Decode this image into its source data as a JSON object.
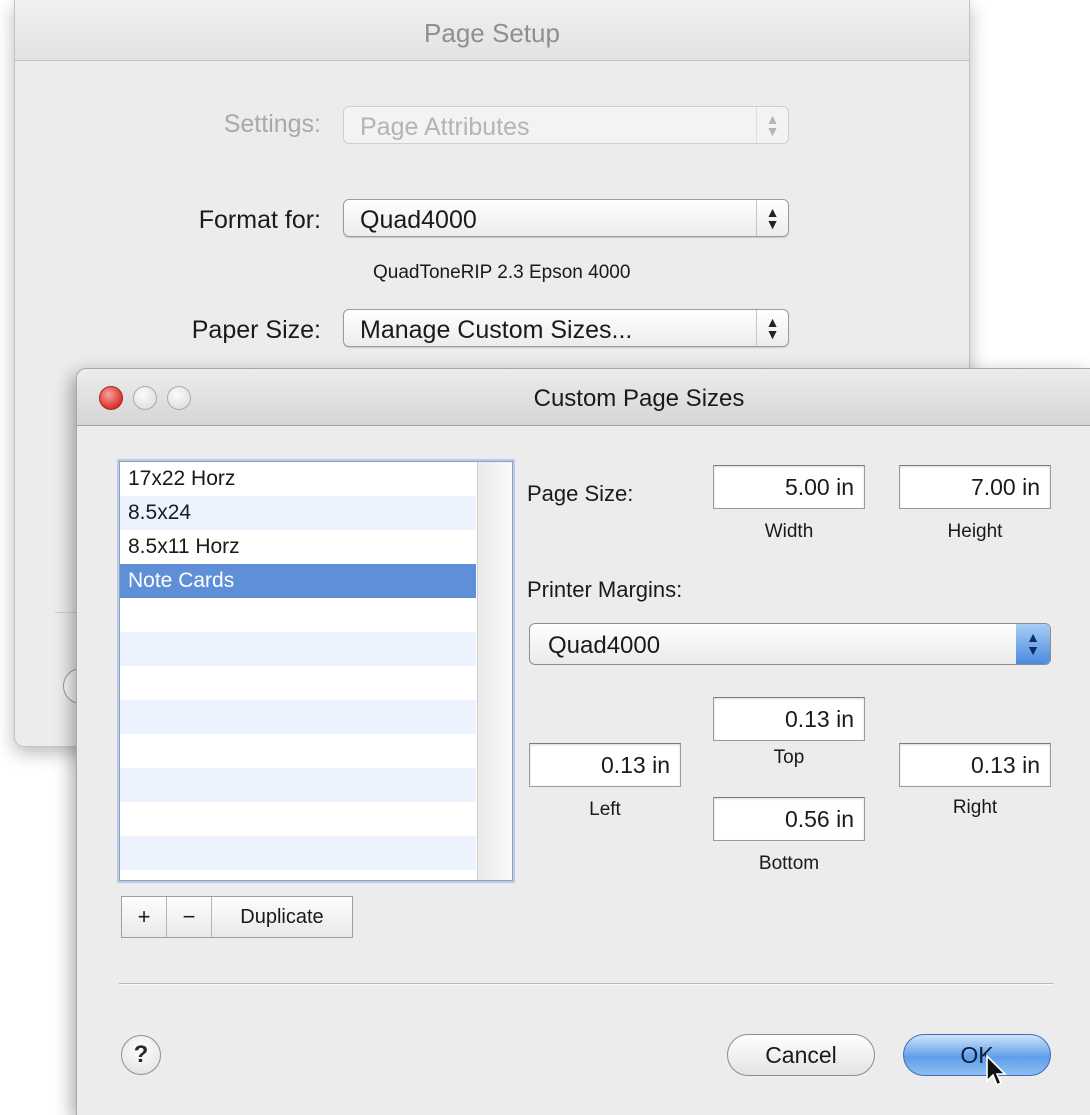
{
  "page_setup": {
    "title": "Page Setup",
    "settings": {
      "label": "Settings:",
      "value": "Page Attributes"
    },
    "format_for": {
      "label": "Format for:",
      "value": "Quad4000",
      "subtitle": "QuadToneRIP 2.3 Epson 4000"
    },
    "paper_size": {
      "label": "Paper Size:",
      "value": "Manage Custom Sizes..."
    }
  },
  "custom_sizes": {
    "title": "Custom Page Sizes",
    "list": [
      {
        "label": "17x22 Horz",
        "selected": false
      },
      {
        "label": "8.5x24",
        "selected": false
      },
      {
        "label": "8.5x11 Horz",
        "selected": false
      },
      {
        "label": "Note Cards",
        "selected": true
      }
    ],
    "buttons": {
      "add": "+",
      "remove": "−",
      "duplicate": "Duplicate"
    },
    "page_size": {
      "label": "Page Size:",
      "width": "5.00 in",
      "width_caption": "Width",
      "height": "7.00 in",
      "height_caption": "Height"
    },
    "printer_margins": {
      "label": "Printer Margins:",
      "printer": "Quad4000",
      "top": "0.13 in",
      "top_caption": "Top",
      "left": "0.13 in",
      "left_caption": "Left",
      "right": "0.13 in",
      "right_caption": "Right",
      "bottom": "0.56 in",
      "bottom_caption": "Bottom"
    },
    "help": "?",
    "cancel": "Cancel",
    "ok": "OK"
  },
  "icons": [
    "close-icon",
    "minimize-icon",
    "zoom-icon",
    "popup-arrows-icon",
    "help-icon",
    "pointer-cursor-icon"
  ],
  "colors": {
    "selection": "#5f8fd6",
    "default_button": "#5f9ee9",
    "close_light": "#d9322b"
  }
}
